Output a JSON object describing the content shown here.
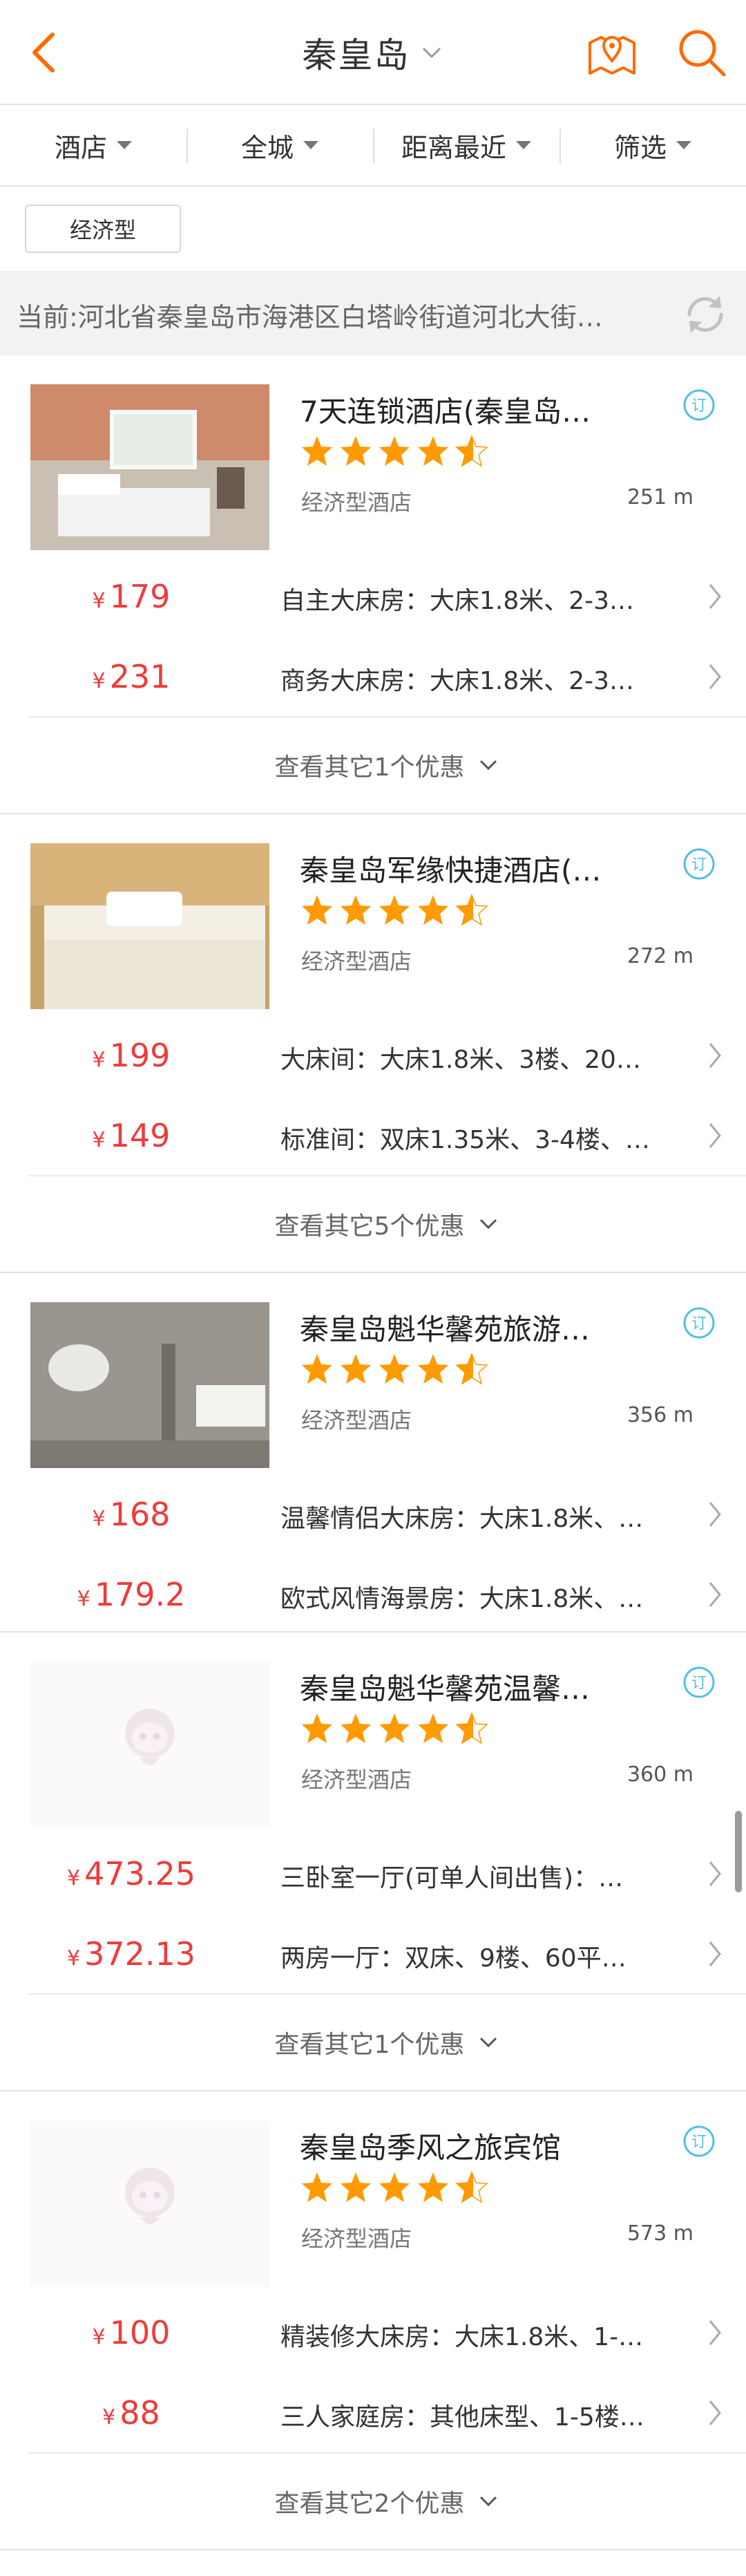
{
  "header": {
    "title": "秦皇岛"
  },
  "filters": [
    {
      "label": "酒店"
    },
    {
      "label": "全城"
    },
    {
      "label": "距离最近"
    },
    {
      "label": "筛选"
    }
  ],
  "tag": {
    "label": "经济型"
  },
  "location": {
    "text": "当前:河北省秦皇岛市海港区白塔岭街道河北大街…"
  },
  "colors": {
    "accent": "#ff6a00",
    "price": "#ee3b3b",
    "star": "#ff9a00",
    "book": "#50c0e8"
  },
  "hotels": [
    {
      "name": "7天连锁酒店(秦皇岛…",
      "rating_stars": 4.5,
      "type": "经济型酒店",
      "distance": "251 m",
      "rooms": [
        {
          "currency": "¥",
          "price": "179",
          "desc": "自主大床房：大床1.8米、2-3…"
        },
        {
          "currency": "¥",
          "price": "231",
          "desc": "商务大床房：大床1.8米、2-3…"
        }
      ],
      "more": "查看其它1个优惠"
    },
    {
      "name": "秦皇岛军缘快捷酒店(…",
      "rating_stars": 4.5,
      "type": "经济型酒店",
      "distance": "272 m",
      "rooms": [
        {
          "currency": "¥",
          "price": "199",
          "desc": "大床间：大床1.8米、3楼、20…"
        },
        {
          "currency": "¥",
          "price": "149",
          "desc": "标准间：双床1.35米、3-4楼、…"
        }
      ],
      "more": "查看其它5个优惠"
    },
    {
      "name": "秦皇岛魁华馨苑旅游…",
      "rating_stars": 4.5,
      "type": "经济型酒店",
      "distance": "356 m",
      "rooms": [
        {
          "currency": "¥",
          "price": "168",
          "desc": "温馨情侣大床房：大床1.8米、…"
        },
        {
          "currency": "¥",
          "price": "179.2",
          "desc": "欧式风情海景房：大床1.8米、…"
        }
      ],
      "more": ""
    },
    {
      "name": "秦皇岛魁华馨苑温馨…",
      "rating_stars": 4.5,
      "type": "经济型酒店",
      "distance": "360 m",
      "rooms": [
        {
          "currency": "¥",
          "price": "473.25",
          "desc": "三卧室一厅(可单人间出售)：…"
        },
        {
          "currency": "¥",
          "price": "372.13",
          "desc": "两房一厅：双床、9楼、60平…"
        }
      ],
      "more": "查看其它1个优惠"
    },
    {
      "name": "秦皇岛季风之旅宾馆",
      "rating_stars": 4.5,
      "type": "经济型酒店",
      "distance": "573 m",
      "rooms": [
        {
          "currency": "¥",
          "price": "100",
          "desc": "精装修大床房：大床1.8米、1-…"
        },
        {
          "currency": "¥",
          "price": "88",
          "desc": "三人家庭房：其他床型、1-5楼…"
        }
      ],
      "more": "查看其它2个优惠"
    }
  ]
}
